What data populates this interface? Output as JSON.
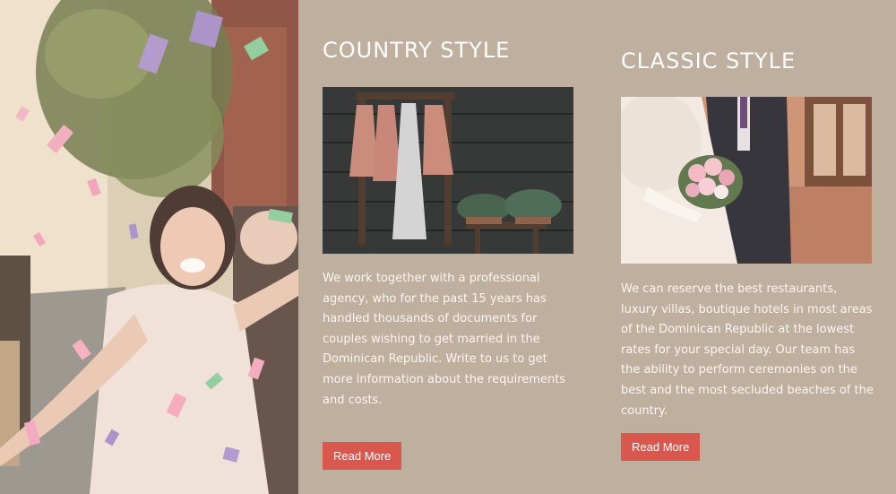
{
  "hero": {
    "image": "bride-confetti-photo"
  },
  "country": {
    "title": "COUNTRY STYLE",
    "image": "dresses-hanging-photo",
    "description": "We work together with a professional agency, who for the past 15 years has handled thousands of documents for couples wishing to get married in the Dominican Republic.  Write to us to get more information about the requirements and costs.",
    "button_label": "Read More"
  },
  "classic": {
    "title": "CLASSIC STYLE",
    "image": "bride-groom-bouquet-photo",
    "description": "We can reserve the best restaurants, luxury villas, boutique hotels in most areas of the Dominican Republic at the lowest rates for your special day. Our team has the ability to perform ceremonies on the best and the most secluded beaches of the country.",
    "button_label": "Read More"
  },
  "colors": {
    "background": "#bfaf9f",
    "button": "#d9574d",
    "text": "#ffffff"
  }
}
